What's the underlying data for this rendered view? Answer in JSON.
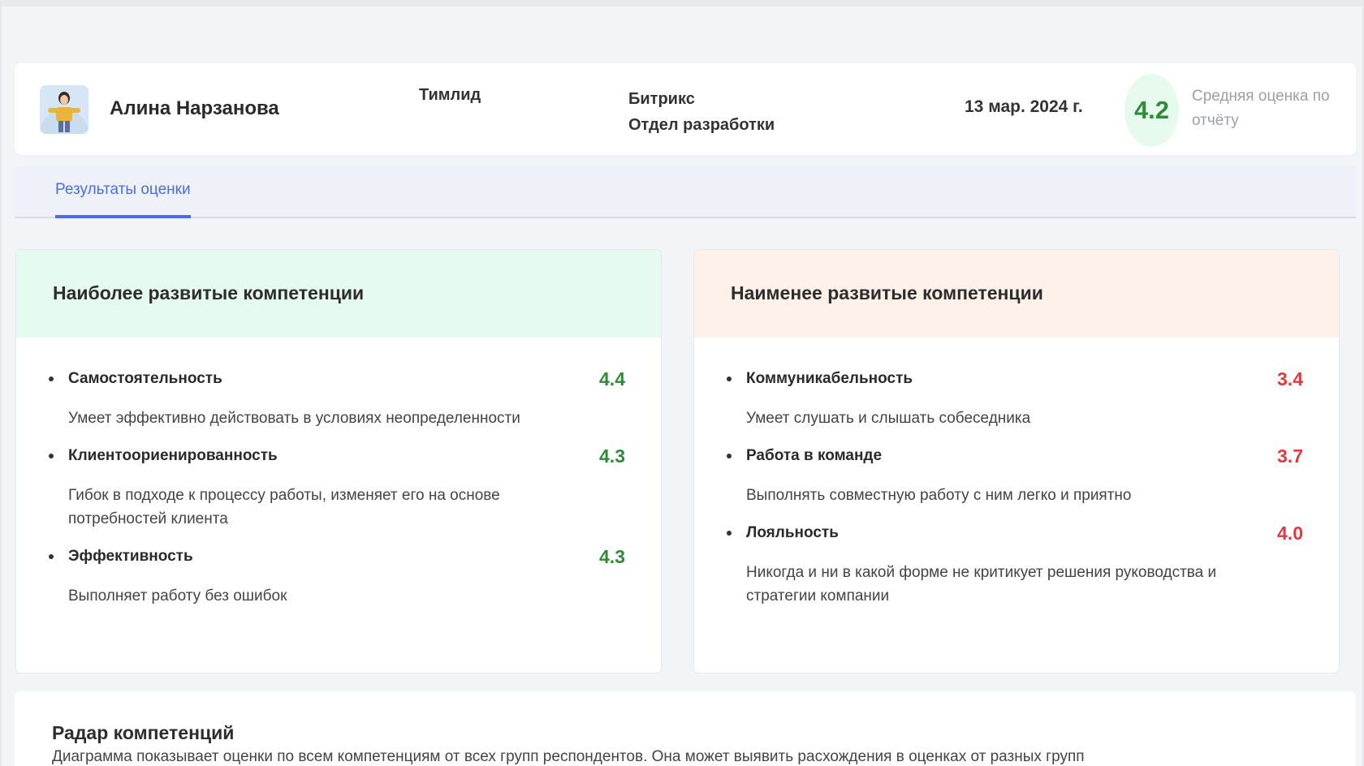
{
  "employee": {
    "name": "Алина Нарзанова",
    "role": "Тимлид",
    "company": "Битрикс",
    "department": "Отдел разработки",
    "date": "13 мар. 2024 г.",
    "average_score": "4.2",
    "average_score_caption": "Средняя оценка по отчёту"
  },
  "tabs": [
    {
      "label": "Результаты оценки",
      "active": true
    }
  ],
  "best": {
    "title": "Наиболее развитые компетенции",
    "items": [
      {
        "name": "Самостоятельность",
        "score": "4.4",
        "description": "Умеет эффективно действовать в условиях неопределенности"
      },
      {
        "name": "Клиентоориенированность",
        "score": "4.3",
        "description": "Гибок в подходе к процессу работы, изменяет его на основе потребностей клиента"
      },
      {
        "name": "Эффективность",
        "score": "4.3",
        "description": "Выполняет работу без ошибок"
      }
    ]
  },
  "worst": {
    "title": "Наименее развитые компетенции",
    "items": [
      {
        "name": "Коммуникабельность",
        "score": "3.4",
        "description": "Умеет слушать и слышать собеседника"
      },
      {
        "name": "Работа в команде",
        "score": "3.7",
        "description": "Выполнять совместную работу с ним легко и приятно"
      },
      {
        "name": "Лояльность",
        "score": "4.0",
        "description": "Никогда и ни в какой форме не критикует решения руководства и стратегии компании"
      }
    ]
  },
  "radar": {
    "title": "Радар компетенций",
    "description": "Диаграмма показывает оценки по всем компетенциям от всех групп респондентов. Она может выявить расхождения в оценках от разных групп"
  },
  "colors": {
    "accent": "#4a6ee0",
    "good": "#2f8a3a",
    "bad": "#e0393e",
    "best_header_bg": "#e5fbef",
    "worst_header_bg": "#fdf1ea"
  }
}
